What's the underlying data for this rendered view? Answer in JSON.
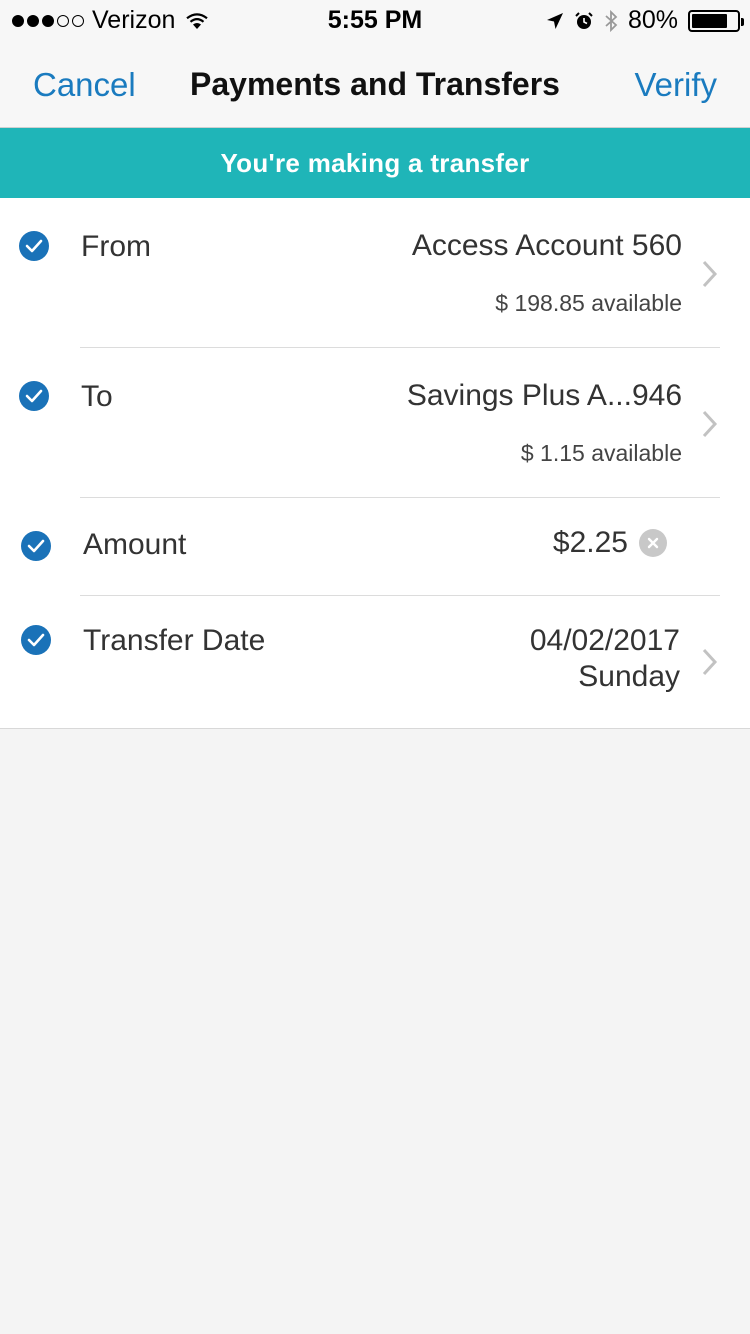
{
  "status_bar": {
    "carrier": "Verizon",
    "time": "5:55 PM",
    "battery": "80%",
    "battery_level": 0.8,
    "signal_bars_filled": 3,
    "signal_bars_total": 5
  },
  "nav": {
    "cancel_label": "Cancel",
    "title": "Payments and Transfers",
    "verify_label": "Verify"
  },
  "banner": {
    "text": "You're making a transfer"
  },
  "form": {
    "from": {
      "label": "From",
      "value": "Access Account 560",
      "sub": "$ 198.85 available"
    },
    "to": {
      "label": "To",
      "value": "Savings Plus A...946",
      "sub": "$ 1.15 available"
    },
    "amount": {
      "label": "Amount",
      "value": "$2.25"
    },
    "date": {
      "label": "Transfer Date",
      "value": "04/02/2017",
      "sub": "Sunday"
    }
  },
  "colors": {
    "accent": "#1a7bbf",
    "banner": "#1fb5b8",
    "check": "#1a72b8",
    "background": "#f4f4f4"
  },
  "icons": [
    "wifi-icon",
    "location-icon",
    "alarm-icon",
    "bluetooth-icon",
    "battery-icon",
    "check-icon",
    "chevron-right-icon",
    "clear-icon"
  ]
}
